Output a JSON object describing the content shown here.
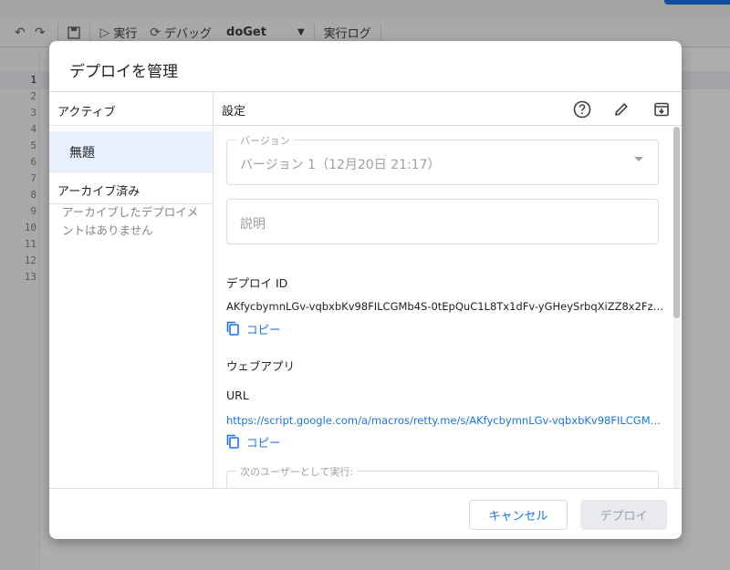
{
  "editor": {
    "toolbar": {
      "run_label": "実行",
      "debug_label": "デバッグ",
      "function_name": "doGet",
      "exec_log_label": "実行ログ"
    },
    "line_numbers": [
      "1",
      "2",
      "3",
      "4",
      "5",
      "6",
      "7",
      "8",
      "9",
      "10",
      "11",
      "12",
      "13"
    ]
  },
  "dialog": {
    "title": "デプロイを管理",
    "left": {
      "active_header": "アクティブ",
      "active_items": [
        "無題"
      ],
      "archived_header": "アーカイブ済み",
      "archived_empty": "アーカイブしたデプロイメントはありません"
    },
    "right": {
      "settings_label": "設定",
      "version_field": {
        "label": "バージョン",
        "value": "バージョン 1（12月20日 21:17）"
      },
      "description_placeholder": "説明",
      "deploy_id_label": "デプロイ ID",
      "deploy_id_value": "AKfycbymnLGv-vqbxbKv98FILCGMb4S-0tEpQuC1L8Tx1dFv-yGHeySrbqXiZZ8x2FzWoT...",
      "copy_label": "コピー",
      "webapp_label": "ウェブアプリ",
      "url_label": "URL",
      "url_value": "https://script.google.com/a/macros/retty.me/s/AKfycbymnLGv-vqbxbKv98FILCGMb4...",
      "execute_as_label": "次のユーザーとして実行:"
    },
    "footer": {
      "cancel_label": "キャンセル",
      "deploy_label": "デプロイ"
    }
  },
  "colors": {
    "accent": "#1a73e8",
    "selected_bg": "#e8f0fe",
    "overlay": "rgba(0,0,0,0.32)"
  }
}
